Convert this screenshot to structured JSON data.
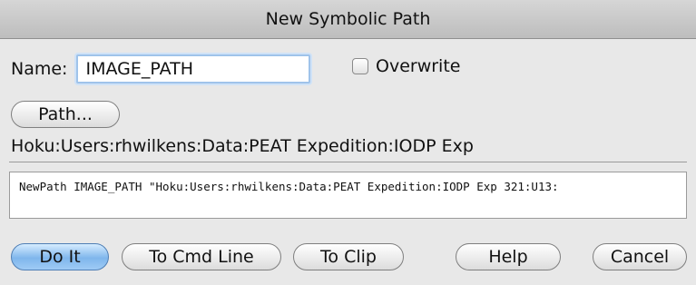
{
  "window": {
    "title": "New Symbolic Path"
  },
  "name_field": {
    "label": "Name:",
    "value": "IMAGE_PATH"
  },
  "overwrite": {
    "label": "Overwrite",
    "checked": false
  },
  "path_button": {
    "label": "Path..."
  },
  "path_display": "Hoku:Users:rhwilkens:Data:PEAT Expedition:IODP Exp",
  "command": "NewPath IMAGE_PATH \"Hoku:Users:rhwilkens:Data:PEAT Expedition:IODP Exp 321:U13:",
  "buttons": {
    "do_it": "Do It",
    "to_cmd_line": "To Cmd Line",
    "to_clip": "To Clip",
    "help": "Help",
    "cancel": "Cancel"
  }
}
